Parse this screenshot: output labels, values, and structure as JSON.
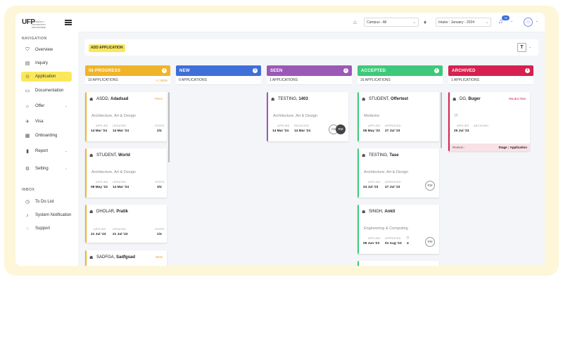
{
  "sidebar": {
    "logo_text": "UFP",
    "logo_tag": "UNIVERSITY FOUNDATION PROGRAMME",
    "nav_heading": "NAVIGATION",
    "items": [
      {
        "label": "Overview",
        "icon": "shield-icon"
      },
      {
        "label": "Inquiry",
        "icon": "doc-icon"
      },
      {
        "label": "Application",
        "icon": "cursor-icon",
        "active": true
      },
      {
        "label": "Documentation",
        "icon": "folder-icon"
      },
      {
        "label": "Offer",
        "icon": "bulb-icon",
        "has_submenu": true
      },
      {
        "label": "Visa",
        "icon": "plane-icon"
      },
      {
        "label": "Onboarding",
        "icon": "board-icon"
      },
      {
        "label": "Report",
        "icon": "chart-icon",
        "has_submenu": true
      },
      {
        "label": "Setting",
        "icon": "gear-icon",
        "has_submenu": true
      }
    ],
    "inbox_heading": "INBOX",
    "inbox_items": [
      {
        "label": "To Do List",
        "icon": "clock-icon"
      },
      {
        "label": "System Notification",
        "icon": "bell-icon"
      },
      {
        "label": "Support",
        "icon": "chat-icon"
      }
    ]
  },
  "topbar": {
    "campus_select": "Campus - All",
    "intake_select": "Intake : January - 2024",
    "notification_count": "76"
  },
  "actions": {
    "add_application": "ADD APPLICATION",
    "filter_label": "T"
  },
  "columns": [
    {
      "title": "IN-PROGRESS",
      "color": "#f0b429",
      "count": "10 APPLICATIONS",
      "new": "+1 NEW"
    },
    {
      "title": "NEW",
      "color": "#3f6fd8",
      "count": "0 APPLICATIONS"
    },
    {
      "title": "SEEN",
      "color": "#9b59b6",
      "count": "1 APPLICATIONS"
    },
    {
      "title": "ACCEPTED",
      "color": "#3ec97a",
      "count": "16 APPLICATIONS"
    },
    {
      "title": "ARCHIVED",
      "color": "#d6204f",
      "count": "1 APPLICATIONS"
    }
  ],
  "cards": {
    "c1": {
      "surname": "ASDD,",
      "first": "Adadsad",
      "status": "PRIO",
      "program": "Architecture, Art & Design",
      "l1": "APPLIED",
      "v1": "14 Mar '24",
      "l2": "UPDATED",
      "v2": "14 Mar '24",
      "l3": "STEPS",
      "v3": "2/4"
    },
    "c2": {
      "surname": "STUDENT,",
      "first": "World",
      "program": "Architecture, Art & Design",
      "l1": "APPLIED",
      "v1": "08 May '23",
      "l2": "UPDATED",
      "v2": "14 Mar '24",
      "l3": "STEPS",
      "v3": "3/4"
    },
    "c3": {
      "surname": "DHOLAR,",
      "first": "Pratik",
      "program": "",
      "l1": "APPLIED",
      "v1": "21 Jul '23",
      "l2": "UPDATED",
      "v2": "21 Jul '23",
      "l3": "STEPS",
      "v3": "1/4"
    },
    "c4": {
      "surname": "SADFGA,",
      "first": "Sadfgsad",
      "status": "NEW"
    },
    "c5": {
      "surname": "TESTING,",
      "first": "1403",
      "program": "Architecture, Art & Design",
      "l1": "APPLIED",
      "v1": "14 Mar '24",
      "l2": "RECEIVED",
      "v2": "14 Mar '24",
      "a1": "AG",
      "a2": "RM"
    },
    "c6": {
      "surname": "STUDENT,",
      "first": "Offertest",
      "program": "Medicine",
      "l1": "APPLIED",
      "v1": "06 May '23",
      "l2": "APPROVED",
      "v2": "27 Jul '23"
    },
    "c7": {
      "surname": "TESTING,",
      "first": "Tase",
      "program": "Architecture, Art & Design",
      "l1": "APPLIED",
      "v1": "24 Jul '23",
      "l2": "APPROVED",
      "v2": "27 Jul '23",
      "a1": "RM"
    },
    "c8": {
      "surname": "SINGH,",
      "first": "Ankit",
      "program": "Engineering & Computing",
      "l1": "APPLIED",
      "v1": "09 Jun '23",
      "l2": "APPROVED",
      "v2": "01 Aug '23",
      "v3": "4",
      "a1": "RM"
    },
    "c9": {
      "surname": "DG,",
      "first": "Buger",
      "status": "REJECTED",
      "program": "IT",
      "l1": "APPLIED",
      "v1": "25 Jul '23",
      "l2": "ARCHIVED",
      "v2": "",
      "reason_label": "Reason :",
      "reason_value": "Stage : Application"
    }
  },
  "colors": {
    "accent": "#fbe85a",
    "brand_blue": "#3f6fd8"
  }
}
